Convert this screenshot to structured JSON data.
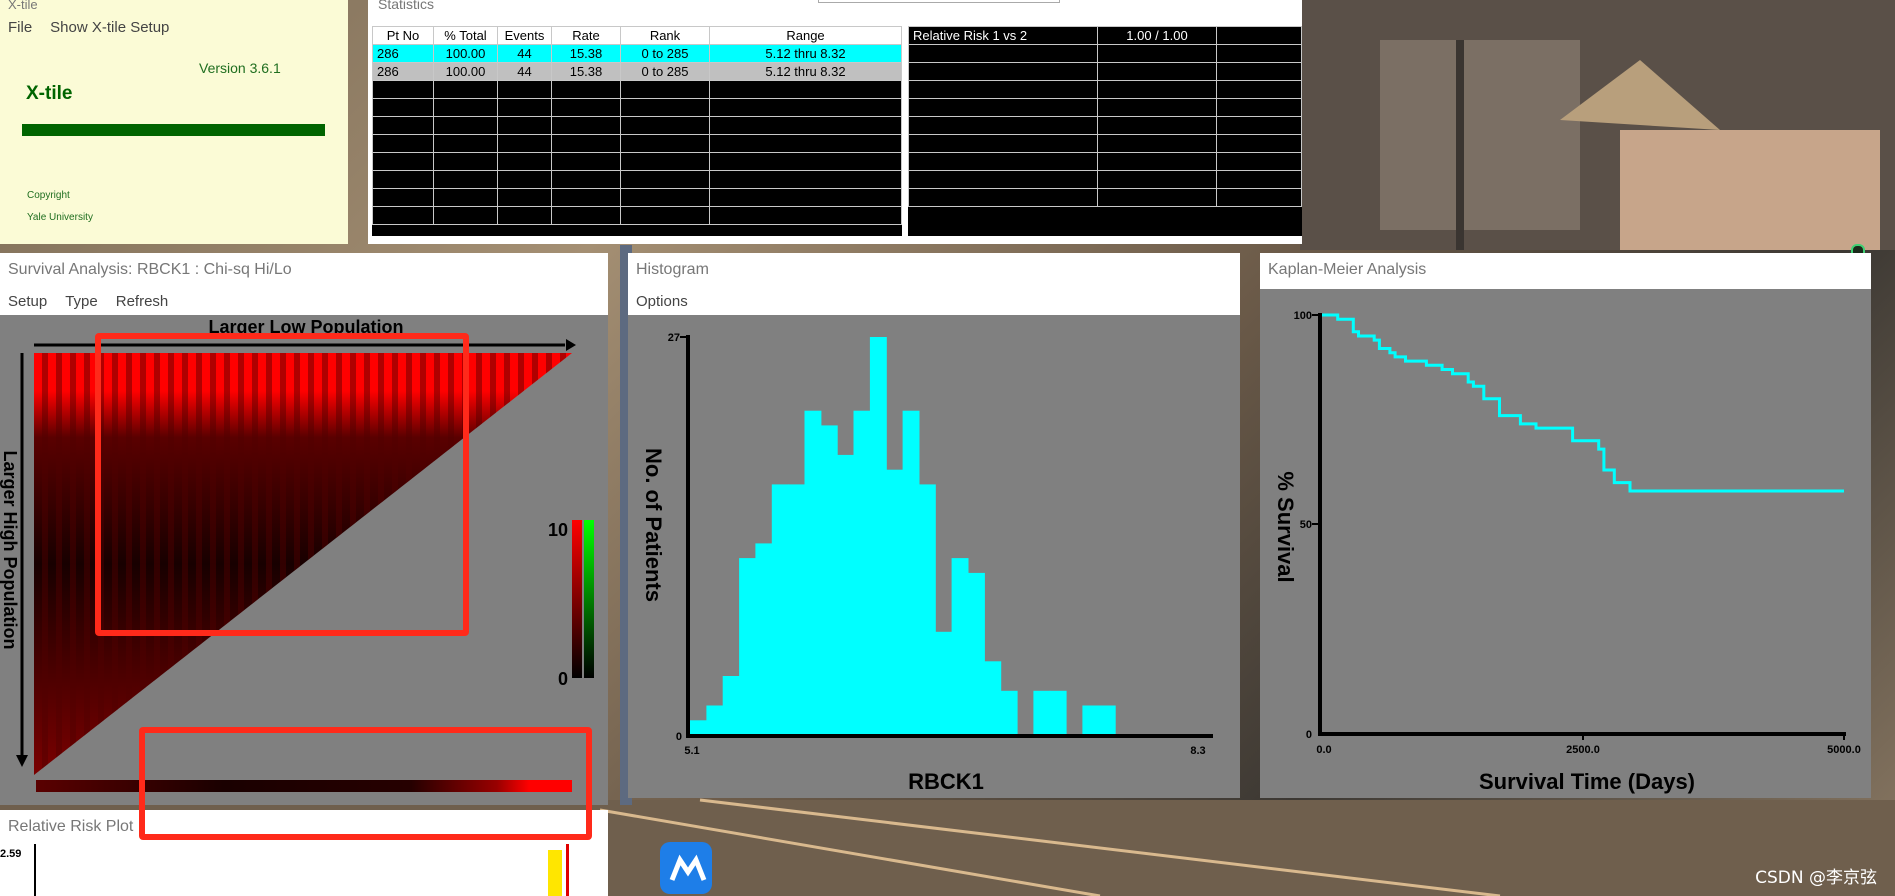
{
  "xtile_window": {
    "title": "X-tile",
    "menu": [
      "File",
      "Show X-tile Setup"
    ],
    "version": "Version 3.6.1",
    "app_name": "X-tile",
    "copyright": "Copyright",
    "institution": "Yale University"
  },
  "statistics_window": {
    "title": "Statistics",
    "columns": [
      "Pt No",
      "% Total",
      "Events",
      "Rate",
      "Rank",
      "Range"
    ],
    "rows": [
      [
        "286",
        "100.00",
        "44",
        "15.38",
        "0 to 285",
        "5.12 thru 8.32"
      ],
      [
        "286",
        "100.00",
        "44",
        "15.38",
        "0 to 285",
        "5.12 thru 8.32"
      ]
    ],
    "risk_label": "Relative Risk 1 vs 2",
    "risk_value": "1.00 / 1.00"
  },
  "survival_window": {
    "title": "Survival Analysis: RBCK1 : Chi-sq Hi/Lo",
    "menu": [
      "Setup",
      "Type",
      "Refresh"
    ],
    "top_axis_label": "Larger Low Population",
    "left_axis_label": "Larger High Population",
    "scale_max": "10",
    "scale_min": "0"
  },
  "histogram_window": {
    "title": "Histogram",
    "menu": [
      "Options"
    ]
  },
  "km_window": {
    "title": "Kaplan-Meier Analysis"
  },
  "risk_plot_window": {
    "title": "Relative Risk Plot",
    "y_max": "2.59"
  },
  "desktop": {
    "watermark": "CSDN @李京弦"
  },
  "colors": {
    "bar": "#00ffff",
    "plot_bg": "#808080",
    "heat_high": "#ff0000",
    "annotation": "#ff2a1a",
    "xtile_green": "#006400"
  },
  "chart_data": [
    {
      "type": "bar",
      "title": "",
      "xlabel": "RBCK1",
      "ylabel": "No. of Patients",
      "x_ticks": [
        "5.1",
        "8.3"
      ],
      "y_ticks": [
        "0",
        "27"
      ],
      "ylim": [
        0,
        27
      ],
      "xlim": [
        5.1,
        8.3
      ],
      "bin_width": 0.103,
      "values": [
        1,
        2,
        4,
        12,
        13,
        17,
        17,
        22,
        21,
        19,
        22,
        27,
        18,
        22,
        17,
        7,
        12,
        11,
        5,
        3,
        0,
        3,
        3,
        0,
        2,
        2,
        0,
        0,
        0,
        0,
        0
      ]
    },
    {
      "type": "line",
      "title": "",
      "xlabel": "Survival Time (Days)",
      "ylabel": "% Survival",
      "x_ticks": [
        "0.0",
        "2500.0",
        "5000.0"
      ],
      "y_ticks": [
        "0",
        "50",
        "100"
      ],
      "xlim": [
        0,
        5000
      ],
      "ylim": [
        0,
        100
      ],
      "series": [
        {
          "x": [
            0,
            150,
            300,
            350,
            500,
            550,
            650,
            700,
            800,
            900,
            1000,
            1150,
            1250,
            1400,
            1450,
            1550,
            1700,
            1900,
            2050,
            2400,
            2650,
            2700,
            2800,
            2950,
            3000,
            5000
          ],
          "y": [
            100,
            99,
            96,
            95,
            94,
            92,
            91,
            90,
            89,
            89,
            88,
            87,
            86,
            84,
            83,
            80,
            76,
            74,
            73,
            70,
            68,
            63,
            60,
            58,
            58,
            58
          ]
        }
      ]
    }
  ]
}
